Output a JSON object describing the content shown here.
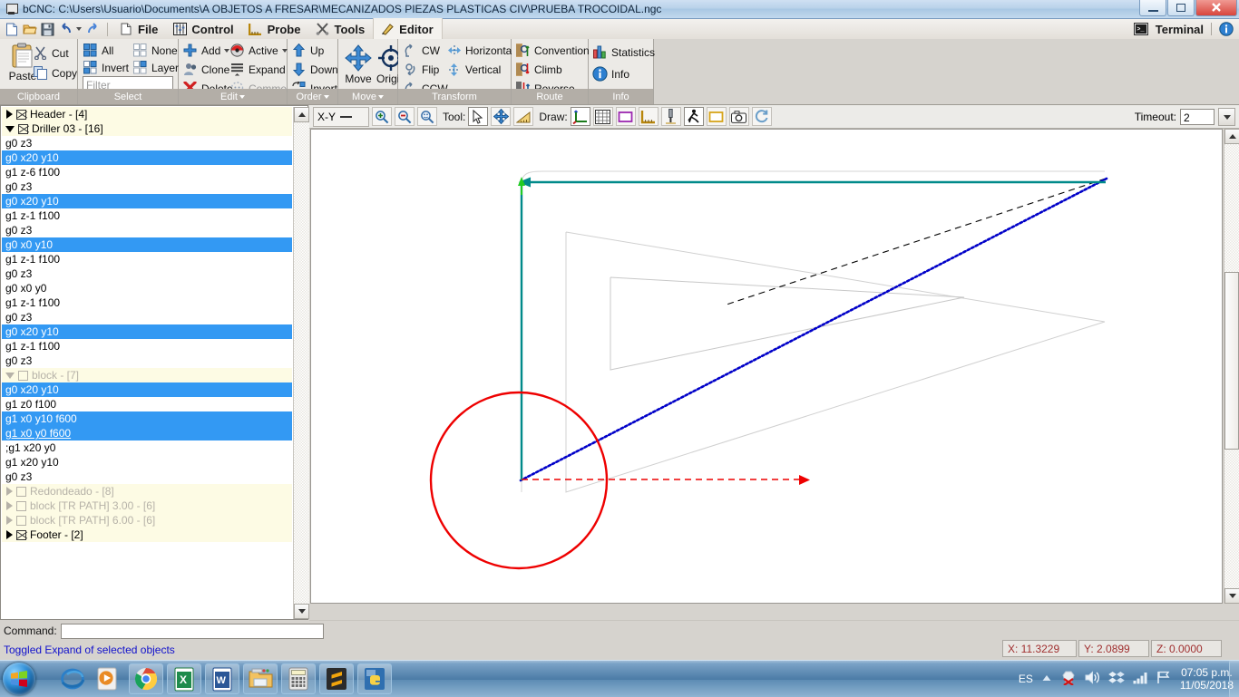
{
  "window": {
    "title": "bCNC: C:\\Users\\Usuario\\Documents\\A OBJETOS A FRESAR\\MECANIZADOS PIEZAS PLASTICAS CIV\\PRUEBA TROCOIDAL.ngc",
    "minimize": "—",
    "maximize": "❐",
    "close": "✕"
  },
  "menu": {
    "items": [
      {
        "label": "File",
        "icon": "new-file-icon"
      },
      {
        "label": "Control",
        "icon": "sliders-icon"
      },
      {
        "label": "Probe",
        "icon": "ruler-icon"
      },
      {
        "label": "Tools",
        "icon": "tools-icon"
      },
      {
        "label": "Editor",
        "icon": "editor-pen-icon"
      }
    ],
    "active": "Editor",
    "terminal_label": "Terminal",
    "quick_icons": [
      "new-icon",
      "open-icon",
      "save-icon",
      "undo-icon",
      "undo-dropdown-icon",
      "redo-icon"
    ]
  },
  "ribbon": {
    "groups": [
      {
        "name": "Clipboard",
        "label": "Clipboard",
        "has_caret": false,
        "big": {
          "label": "Paste",
          "icon": "clipboard-icon"
        },
        "items": [
          {
            "label": "Cut",
            "icon": "scissors-icon"
          },
          {
            "label": "Copy",
            "icon": "copy-icon"
          }
        ]
      },
      {
        "name": "Select",
        "label": "Select",
        "has_caret": false,
        "items": [
          {
            "label": "All",
            "icon": "select-all-icon"
          },
          {
            "label": "None",
            "icon": "select-none-icon"
          },
          {
            "label": "Invert",
            "icon": "select-invert-icon"
          },
          {
            "label": "Layer",
            "icon": "select-layer-icon"
          }
        ],
        "filter_placeholder": "Filter"
      },
      {
        "name": "Edit",
        "label": "Edit",
        "has_caret": true,
        "items": [
          {
            "label": "Add",
            "icon": "plus-icon",
            "dropdown": true
          },
          {
            "label": "Active",
            "icon": "active-icon",
            "dropdown": true
          },
          {
            "label": "Clone",
            "icon": "clone-icon"
          },
          {
            "label": "Expand",
            "icon": "expand-icon"
          },
          {
            "label": "Delete",
            "icon": "delete-x-icon"
          },
          {
            "label": "Comment",
            "icon": "comment-icon",
            "disabled": true
          }
        ]
      },
      {
        "name": "Order",
        "label": "Order",
        "has_caret": true,
        "items": [
          {
            "label": "Up",
            "icon": "arrow-up-icon"
          },
          {
            "label": "Down",
            "icon": "arrow-down-icon"
          },
          {
            "label": "Invert",
            "icon": "order-invert-icon"
          }
        ]
      },
      {
        "name": "Move",
        "label": "Move",
        "has_caret": true,
        "big_items": [
          {
            "label": "Move",
            "icon": "move-cross-icon"
          },
          {
            "label": "Origin",
            "icon": "origin-target-icon"
          }
        ]
      },
      {
        "name": "Transform",
        "label": "Transform",
        "has_caret": false,
        "items": [
          {
            "label": "CW",
            "icon": "rotate-cw-icon"
          },
          {
            "label": "Horizontal",
            "icon": "mirror-horizontal-icon"
          },
          {
            "label": "Flip",
            "icon": "flip-icon"
          },
          {
            "label": "Vertical",
            "icon": "mirror-vertical-icon"
          },
          {
            "label": "CCW",
            "icon": "rotate-ccw-icon"
          }
        ]
      },
      {
        "name": "Route",
        "label": "Route",
        "has_caret": false,
        "items": [
          {
            "label": "Conventional",
            "icon": "conventional-icon"
          },
          {
            "label": "Climb",
            "icon": "climb-icon"
          },
          {
            "label": "Reverse",
            "icon": "reverse-icon"
          }
        ]
      },
      {
        "name": "Info",
        "label": "Info",
        "has_caret": false,
        "items": [
          {
            "label": "Statistics",
            "icon": "statistics-icon"
          },
          {
            "label": "Info",
            "icon": "info-icon"
          }
        ]
      }
    ]
  },
  "tree": {
    "rows": [
      {
        "text": "Header - [4]",
        "type": "header",
        "expander": "collapsed",
        "box": "x"
      },
      {
        "text": "Driller 03 - [16]",
        "type": "header",
        "expander": "expanded",
        "box": "x"
      },
      {
        "text": "g0 z3",
        "type": "plain"
      },
      {
        "text": "g0 x20 y10",
        "type": "selected"
      },
      {
        "text": "g1 z-6 f100",
        "type": "plain"
      },
      {
        "text": "g0 z3",
        "type": "plain"
      },
      {
        "text": "g0 x20 y10",
        "type": "selected"
      },
      {
        "text": "g1 z-1 f100",
        "type": "plain"
      },
      {
        "text": "g0 z3",
        "type": "plain"
      },
      {
        "text": "g0 x0 y10",
        "type": "selected"
      },
      {
        "text": "g1 z-1 f100",
        "type": "plain"
      },
      {
        "text": "g0 z3",
        "type": "plain"
      },
      {
        "text": "g0 x0 y0",
        "type": "plain"
      },
      {
        "text": "g1 z-1 f100",
        "type": "plain"
      },
      {
        "text": "g0 z3",
        "type": "plain"
      },
      {
        "text": "g0 x20 y10",
        "type": "selected"
      },
      {
        "text": "g1 z-1 f100",
        "type": "plain"
      },
      {
        "text": "g0 z3",
        "type": "plain"
      },
      {
        "text": "block - [7]",
        "type": "block-dim",
        "expander": "expanded",
        "box": "plain"
      },
      {
        "text": "g0 x20 y10",
        "type": "selected"
      },
      {
        "text": "g1 z0 f100",
        "type": "plain"
      },
      {
        "text": "g1 x0 y10 f600",
        "type": "selected"
      },
      {
        "text": "g1 x0 y0 f600",
        "type": "selected-underline"
      },
      {
        "text": ";g1 x20 y0",
        "type": "plain"
      },
      {
        "text": "g1 x20 y10",
        "type": "plain"
      },
      {
        "text": "g0 z3",
        "type": "plain"
      },
      {
        "text": "Redondeado - [8]",
        "type": "block-dim",
        "expander": "collapsed",
        "box": "plain"
      },
      {
        "text": "block [TR PATH] 3.00 - [6]",
        "type": "block-dim",
        "expander": "collapsed",
        "box": "plain"
      },
      {
        "text": "block [TR PATH] 6.00 - [6]",
        "type": "block-dim",
        "expander": "collapsed",
        "box": "plain"
      },
      {
        "text": "Footer - [2]",
        "type": "header",
        "expander": "collapsed",
        "box": "x"
      }
    ]
  },
  "canvas_toolbar": {
    "view_label": "X-Y",
    "zoom_in_icon": "zoom-in-icon",
    "zoom_out_icon": "zoom-out-icon",
    "zoom_fit_icon": "zoom-fit-icon",
    "tool_label": "Tool:",
    "tool_buttons": [
      {
        "icon": "cursor-select-icon",
        "active": true
      },
      {
        "icon": "pan-move-icon",
        "active": false
      },
      {
        "icon": "ruler-measure-icon",
        "active": false
      }
    ],
    "draw_label": "Draw:",
    "draw_buttons": [
      {
        "icon": "axes-icon",
        "active": true
      },
      {
        "icon": "grid-icon",
        "active": false
      },
      {
        "icon": "margin-rect-icon",
        "active": false
      },
      {
        "icon": "workarea-icon",
        "active": false
      },
      {
        "icon": "probe-icon",
        "active": false
      },
      {
        "icon": "rapid-path-icon",
        "active": true
      },
      {
        "icon": "bounding-box-icon",
        "active": false
      },
      {
        "icon": "camera-icon",
        "active": false
      },
      {
        "icon": "refresh-icon",
        "active": false
      }
    ],
    "timeout_label": "Timeout:",
    "timeout_value": "2"
  },
  "bottom": {
    "command_label": "Command:",
    "command_value": "",
    "status_message": "Toggled Expand of selected objects",
    "dro": [
      {
        "label": "X:",
        "value": "11.3229",
        "full": "X: 11.3229"
      },
      {
        "label": "Y:",
        "value": "2.0899",
        "full": "Y: 2.0899"
      },
      {
        "label": "Z:",
        "value": "0.0000",
        "full": "Z: 0.0000"
      }
    ]
  },
  "taskbar": {
    "start_label": "start-orb",
    "apps": [
      {
        "name": "internet-explorer-icon",
        "framed": false
      },
      {
        "name": "media-player-icon",
        "framed": false
      },
      {
        "name": "google-chrome-icon",
        "framed": true
      },
      {
        "name": "excel-icon",
        "framed": true
      },
      {
        "name": "word-icon",
        "framed": true
      },
      {
        "name": "file-explorer-icon",
        "framed": true
      },
      {
        "name": "calculator-icon",
        "framed": true
      },
      {
        "name": "sublime-text-icon",
        "framed": true
      },
      {
        "name": "python-bcnc-icon",
        "framed": true
      }
    ],
    "tray": {
      "language": "ES",
      "icons": [
        "show-hidden-icon",
        "antivirus-icon",
        "volume-icon",
        "dropbox-icon",
        "network-icon",
        "action-center-icon"
      ],
      "time": "07:05 p.m.",
      "date": "11/05/2018"
    }
  },
  "colors": {
    "selection_blue": "#3399f3",
    "block_cream": "#fdfbe4",
    "teal_path": "#008a8a",
    "blue_dotted": "#0000c8",
    "red_circle": "#ee0000",
    "dro_text": "#a03030",
    "status_text": "#1111cc"
  },
  "drawing": {
    "teal_polyline": "machining path (vertical + horizontal, arrow at top-left)",
    "red_circle_label": "tool circle",
    "blue_dotted_label": "rapid move diagonal",
    "black_dashed_label": "rapid move diagonal upper",
    "red_dashed_label": "X axis arrow",
    "green_arrow_label": "Y axis arrow"
  }
}
